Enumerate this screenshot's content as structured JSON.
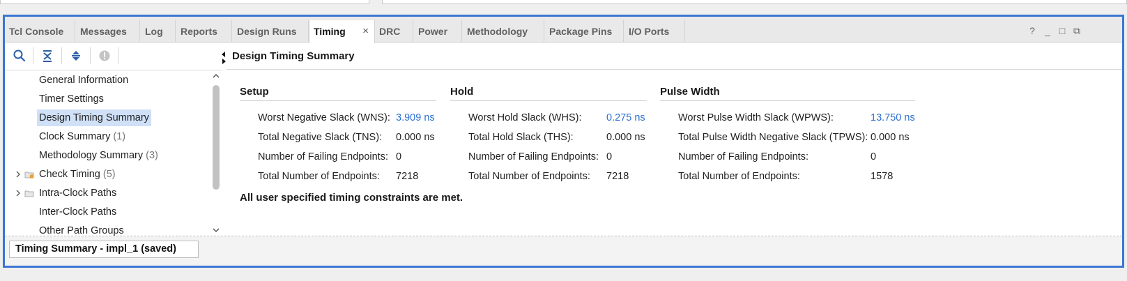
{
  "tabs": [
    {
      "label": "Tcl Console"
    },
    {
      "label": "Messages"
    },
    {
      "label": "Log"
    },
    {
      "label": "Reports"
    },
    {
      "label": "Design Runs"
    },
    {
      "label": "Timing",
      "active": true,
      "close": "×"
    },
    {
      "label": "DRC"
    },
    {
      "label": "Power"
    },
    {
      "label": "Methodology"
    },
    {
      "label": "Package Pins"
    },
    {
      "label": "I/O Ports"
    }
  ],
  "window_controls": {
    "help": "?",
    "minimize": "_",
    "maximize": "□",
    "restore": "⧉"
  },
  "toolbar": {
    "icons": [
      "search-icon",
      "collapse-all-icon",
      "expand-all-icon",
      "stop-icon"
    ]
  },
  "tree": [
    {
      "label": "General Information",
      "count": ""
    },
    {
      "label": "Timer Settings",
      "count": ""
    },
    {
      "label": "Design Timing Summary",
      "count": "",
      "selected": true
    },
    {
      "label": "Clock Summary",
      "count": "(1)"
    },
    {
      "label": "Methodology Summary",
      "count": "(3)"
    },
    {
      "label": "Check Timing",
      "count": "(5)",
      "expandable": true,
      "folder": "warning-folder-icon"
    },
    {
      "label": "Intra-Clock Paths",
      "count": "",
      "expandable": true,
      "folder": "folder-icon"
    },
    {
      "label": "Inter-Clock Paths",
      "count": ""
    },
    {
      "label": "Other Path Groups",
      "count": ""
    }
  ],
  "header": {
    "title": "Design Timing Summary"
  },
  "setup": {
    "title": "Setup",
    "rows": [
      {
        "label": "Worst Negative Slack (WNS):",
        "value": "3.909 ns",
        "link": true
      },
      {
        "label": "Total Negative Slack (TNS):",
        "value": "0.000 ns"
      },
      {
        "label": "Number of Failing Endpoints:",
        "value": "0"
      },
      {
        "label": "Total Number of Endpoints:",
        "value": "7218"
      }
    ]
  },
  "hold": {
    "title": "Hold",
    "rows": [
      {
        "label": "Worst Hold Slack (WHS):",
        "value": "0.275 ns",
        "link": true
      },
      {
        "label": "Total Hold Slack (THS):",
        "value": "0.000 ns"
      },
      {
        "label": "Number of Failing Endpoints:",
        "value": "0"
      },
      {
        "label": "Total Number of Endpoints:",
        "value": "7218"
      }
    ]
  },
  "pulse": {
    "title": "Pulse Width",
    "rows": [
      {
        "label": "Worst Pulse Width Slack (WPWS):",
        "value": "13.750 ns",
        "link": true
      },
      {
        "label": "Total Pulse Width Negative Slack (TPWS):",
        "value": "0.000 ns"
      },
      {
        "label": "Number of Failing Endpoints:",
        "value": "0"
      },
      {
        "label": "Total Number of Endpoints:",
        "value": "1578"
      }
    ]
  },
  "status_message": "All user specified timing constraints are met.",
  "bottom_tab": {
    "label": "Timing Summary - impl_1 (saved)"
  }
}
